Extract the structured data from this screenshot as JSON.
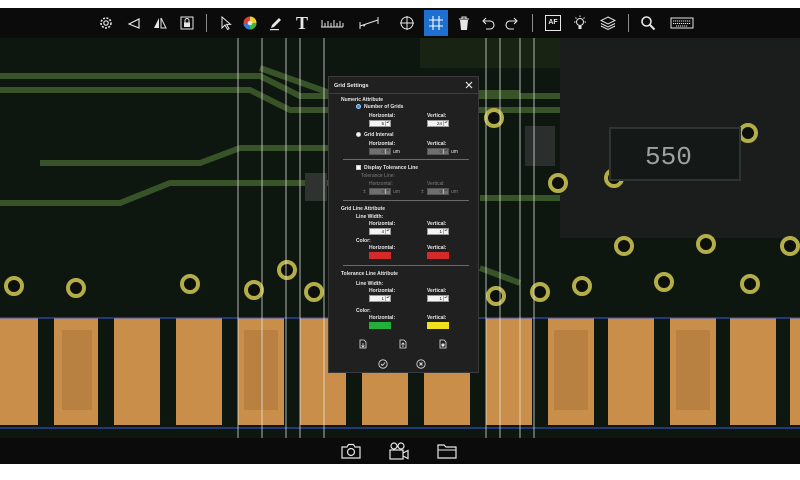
{
  "toolbar": {
    "icons": [
      "settings-icon",
      "line-icon",
      "mirror-icon",
      "lock-icon",
      "pointer-icon",
      "color-wheel-icon",
      "pen-icon",
      "text-icon",
      "ruler-icon",
      "measure-icon",
      "crosshair-icon",
      "grid-icon",
      "trash-icon",
      "undo-icon",
      "redo-icon",
      "autofocus-icon",
      "light-icon",
      "layers-icon",
      "search-icon",
      "keyboard-icon"
    ],
    "text_tool": "T",
    "autofocus": "AF",
    "active_tool": "grid-icon"
  },
  "bottom_bar": {
    "icons": [
      "camera-icon",
      "video-camera-icon",
      "folder-icon"
    ]
  },
  "image": {
    "chip_label": "550"
  },
  "dialog": {
    "title": "Grid Settings",
    "numeric_attribute": "Numeric Attribute",
    "number_of_grids": "Number of Grids",
    "grid_interval": "Grid Interval",
    "horizontal": "Horizontal:",
    "vertical": "Vertical:",
    "grids_h": "5",
    "grids_v": "24",
    "interval_h": "0",
    "interval_v": "0",
    "unit": "um",
    "display_tolerance": "Display Tolerance Line",
    "tolerance_line": "Tolerance Line:",
    "tol_h": "0",
    "tol_v": "0",
    "tol_prefix": "±",
    "grid_line_attribute": "Grid Line Attribute",
    "line_width": "Line Width:",
    "grid_lw_h": "4",
    "grid_lw_v": "1",
    "color": "Color:",
    "grid_color_h": "#d42a2a",
    "grid_color_v": "#d42a2a",
    "tolerance_line_attribute": "Tolerance Line Attribute",
    "tol_lw_h": "1",
    "tol_lw_v": "1",
    "tol_color_h": "#22b03c",
    "tol_color_v": "#f0e020",
    "selected_mode": "number_of_grids"
  }
}
